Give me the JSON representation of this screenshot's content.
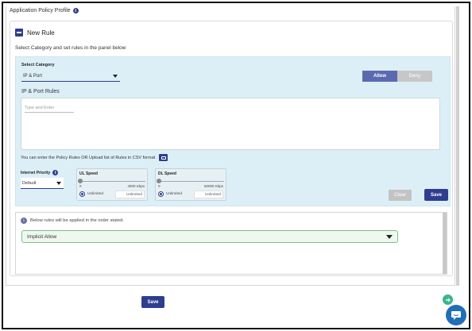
{
  "page": {
    "title": "Application Policy Profile",
    "info_icon": "info-icon"
  },
  "new_rule": {
    "heading": "New Rule",
    "subtitle": "Select Category and set rules in the panel below"
  },
  "rule_panel": {
    "select_category_label": "Select Category",
    "select_category_value": "IP & Port",
    "action_toggle": {
      "allow": "Allow",
      "deny": "Deny",
      "selected": "Allow"
    },
    "rules_title": "IP & Port Rules",
    "rules_input_placeholder": "Type and Enter",
    "csv_hint": "You can enter the Policy Rules OR Upload list of Rules in CSV format",
    "internet_priority_label": "Internet Priority",
    "internet_priority_value": "Default",
    "ul_speed": {
      "label": "UL Speed",
      "min": "0",
      "max": "4000 Kbps",
      "radio_label": "Unlimited",
      "input_value": "Unlimited"
    },
    "dl_speed": {
      "label": "DL Speed",
      "min": "0",
      "max": "50000 Kbps",
      "radio_label": "Unlimited",
      "input_value": "Unlimited"
    },
    "clear_button": "Clear",
    "save_button": "Save"
  },
  "rules_list": {
    "note": "Below rules will be applied in the order stated.",
    "items": [
      "Implicit Allow"
    ]
  },
  "footer": {
    "save_button": "Save"
  },
  "colors": {
    "primary": "#2f3d8f",
    "panel_bg": "#ddeff6",
    "implicit_border": "#7cc08c",
    "fab_green": "#3bb58a",
    "chat_blue": "#1f6fb8"
  }
}
